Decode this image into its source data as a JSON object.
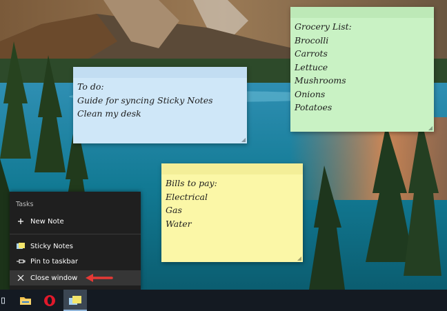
{
  "notes": {
    "todo": {
      "lines": [
        "To do:",
        "Guide for syncing Sticky Notes",
        "Clean my desk"
      ]
    },
    "grocery": {
      "lines": [
        "Grocery List:",
        "Brocolli",
        "Carrots",
        "Lettuce",
        "Mushrooms",
        "Onions",
        "Potatoes"
      ]
    },
    "bills": {
      "lines": [
        "Bills to pay:",
        "Electrical",
        "Gas",
        "Water"
      ]
    }
  },
  "jumplist": {
    "section_title": "Tasks",
    "new_note": "New Note",
    "app_name": "Sticky Notes",
    "pin": "Pin to taskbar",
    "close": "Close window"
  },
  "taskbar": {
    "icons": [
      "file-explorer-icon",
      "opera-icon",
      "sticky-notes-icon"
    ]
  },
  "colors": {
    "note_blue": "#cfe7f8",
    "note_green": "#c9f2c4",
    "note_yellow": "#fbf7a7",
    "jumplist_bg": "#1f1f1f",
    "taskbar_bg": "#141a22",
    "arrow_red": "#e53935"
  }
}
